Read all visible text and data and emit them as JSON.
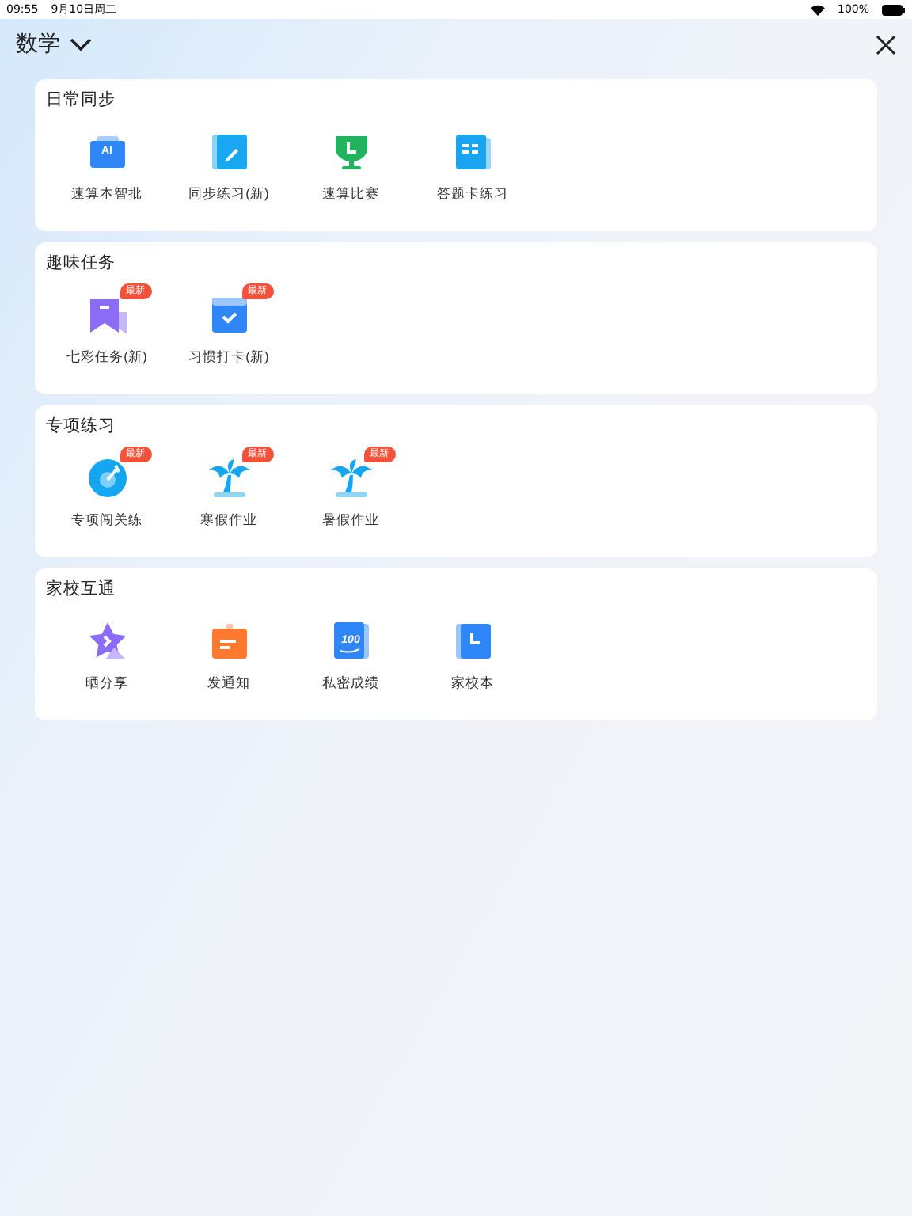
{
  "status_bar": {
    "time": "09:55",
    "date": "9月10日周二",
    "battery": "100%"
  },
  "header": {
    "title": "数学"
  },
  "sections": [
    {
      "title": "日常同步",
      "items": [
        {
          "label": "速算本智批",
          "icon_text": "AI"
        },
        {
          "label": "同步练习(新)"
        },
        {
          "label": "速算比赛"
        },
        {
          "label": "答题卡练习"
        }
      ]
    },
    {
      "title": "趣味任务",
      "items": [
        {
          "label": "七彩任务(新)",
          "badge": "最新"
        },
        {
          "label": "习惯打卡(新)",
          "badge": "最新"
        }
      ]
    },
    {
      "title": "专项练习",
      "items": [
        {
          "label": "专项闯关练",
          "badge": "最新"
        },
        {
          "label": "寒假作业",
          "badge": "最新"
        },
        {
          "label": "暑假作业",
          "badge": "最新"
        }
      ]
    },
    {
      "title": "家校互通",
      "items": [
        {
          "label": "晒分享"
        },
        {
          "label": "发通知"
        },
        {
          "label": "私密成绩",
          "icon_text": "100"
        },
        {
          "label": "家校本"
        }
      ]
    }
  ]
}
